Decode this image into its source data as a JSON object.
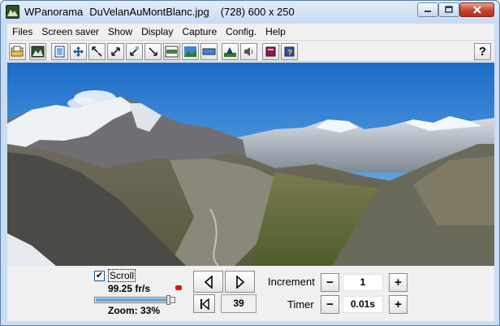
{
  "window": {
    "app_name": "WPanorama",
    "file_name": "DuVelanAuMontBlanc.jpg",
    "image_info": "(728) 600 x 250"
  },
  "menubar": {
    "items": [
      "Files",
      "Screen saver",
      "Show",
      "Display",
      "Capture",
      "Config.",
      "Help"
    ]
  },
  "toolbar": {
    "buttons": [
      "open-folder-icon",
      "picture-icon",
      "fit-page-icon",
      "move-icon",
      "zoom-in-arrows-icon",
      "expand-arrows-icon",
      "shrink-arrows-icon",
      "arrow-down-right-icon",
      "horizon-bar-icon",
      "landscape-icon",
      "flat-bar-icon",
      "mountain-sun-icon",
      "speaker-icon",
      "book-icon",
      "help-book-icon"
    ],
    "help_label": "?"
  },
  "controls": {
    "scroll_label": "Scroll",
    "scroll_checked": true,
    "fps": "99.25 fr/s",
    "zoom_label": "Zoom: 33%",
    "zoom_value": 0.33,
    "frame_counter": "39",
    "increment_label": "Increment",
    "increment_value": "1",
    "timer_label": "Timer",
    "timer_value": "0.01s",
    "minus": "−",
    "plus": "+"
  },
  "colors": {
    "title_bar": "#c9dcf3",
    "close_button": "#c6452c",
    "slider_fill": "#6aa0d8"
  }
}
